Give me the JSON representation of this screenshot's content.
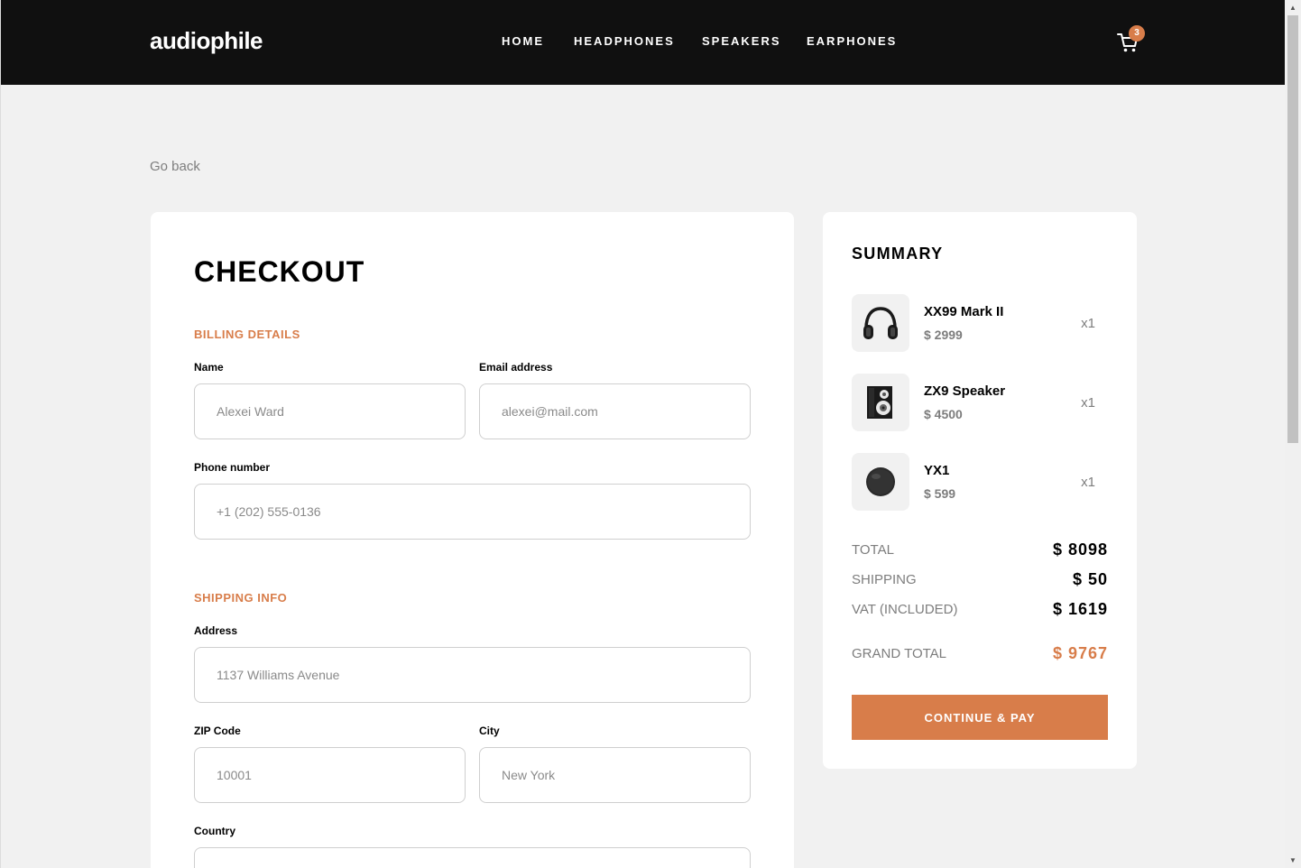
{
  "header": {
    "logo": "audiophile",
    "nav": [
      "HOME",
      "HEADPHONES",
      "SPEAKERS",
      "EARPHONES"
    ],
    "cart_count": "3",
    "cart_icon": "cart-icon"
  },
  "go_back_label": "Go back",
  "checkout": {
    "title": "CHECKOUT",
    "billing": {
      "title": "BILLING DETAILS",
      "name_label": "Name",
      "name_placeholder": "Alexei Ward",
      "email_label": "Email address",
      "email_placeholder": "alexei@mail.com",
      "phone_label": "Phone number",
      "phone_placeholder": "+1 (202) 555-0136"
    },
    "shipping": {
      "title": "SHIPPING INFO",
      "address_label": "Address",
      "address_placeholder": "1137 Williams Avenue",
      "zip_label": "ZIP Code",
      "zip_placeholder": "10001",
      "city_label": "City",
      "city_placeholder": "New York",
      "country_label": "Country",
      "country_placeholder": ""
    }
  },
  "summary": {
    "title": "SUMMARY",
    "items": [
      {
        "name": "XX99 Mark II",
        "price": "$ 2999",
        "qty": "x1",
        "icon": "headphones-icon"
      },
      {
        "name": "ZX9 Speaker",
        "price": "$ 4500",
        "qty": "x1",
        "icon": "speaker-icon"
      },
      {
        "name": "YX1",
        "price": "$ 599",
        "qty": "x1",
        "icon": "earphones-icon"
      }
    ],
    "totals": {
      "total_label": "TOTAL",
      "total_value": "$ 8098",
      "shipping_label": "SHIPPING",
      "shipping_value": "$ 50",
      "vat_label": "VAT (INCLUDED)",
      "vat_value": "$ 1619",
      "grand_label": "GRAND TOTAL",
      "grand_value": "$ 9767"
    },
    "pay_button": "CONTINUE & PAY"
  },
  "colors": {
    "accent": "#d87d4a",
    "header_bg": "#101010",
    "page_bg": "#f1f1f1"
  }
}
